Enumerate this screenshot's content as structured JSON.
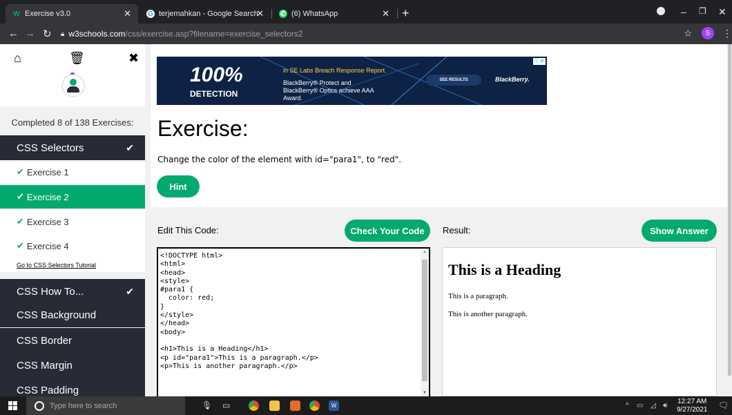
{
  "browser": {
    "tabs": [
      {
        "title": "Exercise v3.0",
        "icon": "w3schools-icon",
        "active": true
      },
      {
        "title": "terjemahkan - Google Search",
        "icon": "google-icon",
        "active": false
      },
      {
        "title": "(6) WhatsApp",
        "icon": "whatsapp-icon",
        "active": false
      }
    ],
    "url_domain": "w3schools.com",
    "url_path": "/css/exercise.asp?filename=exercise_selectors2",
    "profile_initial": "S"
  },
  "sidebar": {
    "completed_text": "Completed 8 of 138 Exercises:",
    "sections": [
      {
        "label": "CSS Selectors",
        "checked": true
      },
      {
        "label": "CSS How To...",
        "checked": true
      },
      {
        "label": "CSS Background",
        "checked": false
      },
      {
        "label": "CSS Border",
        "checked": false
      },
      {
        "label": "CSS Margin",
        "checked": false
      },
      {
        "label": "CSS Padding",
        "checked": false
      }
    ],
    "exercises": [
      {
        "label": "Exercise 1",
        "active": false
      },
      {
        "label": "Exercise 2",
        "active": true
      },
      {
        "label": "Exercise 3",
        "active": false
      },
      {
        "label": "Exercise 4",
        "active": false
      }
    ],
    "tutorial_link": "Go to CSS Selectors Tutorial"
  },
  "ad": {
    "headline": "100%",
    "subheadline": "DETECTION",
    "line1": "in SE Labs Breach Response Report.",
    "line2": "BlackBerry® Protect and BlackBerry® Optics achieve AAA Award.",
    "cta": "SEE RESULTS",
    "brand": "BlackBerry."
  },
  "exercise": {
    "title": "Exercise:",
    "instruction": "Change the color of the element with id=\"para1\", to \"red\".",
    "hint_label": "Hint",
    "edit_label": "Edit This Code:",
    "check_label": "Check Your Code",
    "result_label": "Result:",
    "answer_label": "Show Answer",
    "code": "<!DOCTYPE html>\n<html>\n<head>\n<style>\n#para1 {\n  color: red;\n}\n</style>\n</head>\n<body>\n\n<h1>This is a Heading</h1>\n<p id=\"para1\">This is a paragraph.</p>\n<p>This is another paragraph.</p>",
    "result_heading": "This is a Heading",
    "result_p1": "This is a paragraph.",
    "result_p2": "This is another paragraph."
  },
  "taskbar": {
    "search_placeholder": "Type here to search",
    "time": "12:27 AM",
    "date": "9/27/2021"
  },
  "colors": {
    "accent": "#04aa6d",
    "sidebar_dark": "#282a35",
    "browser_dark": "#202124"
  }
}
